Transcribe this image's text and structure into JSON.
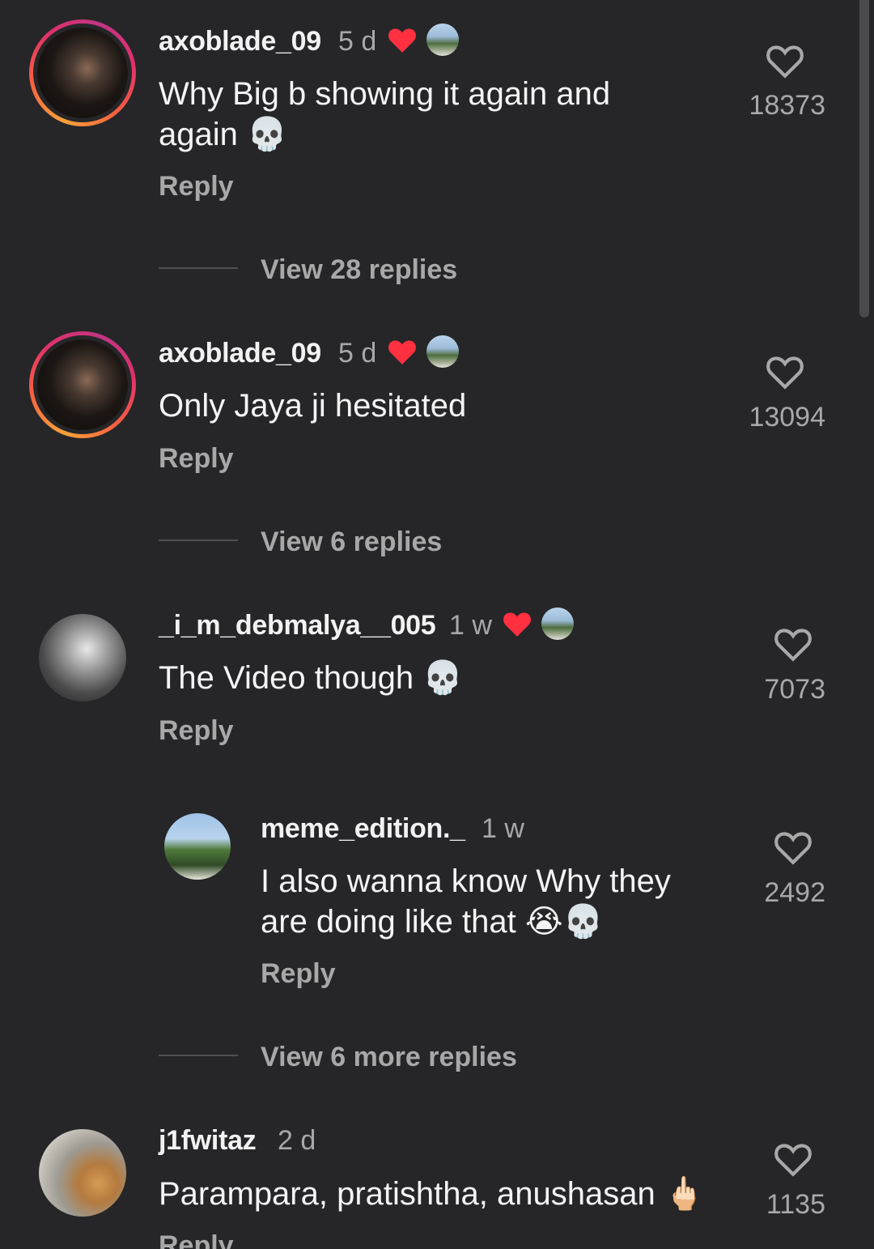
{
  "comments": [
    {
      "username": "axoblade_09",
      "time": "5 d",
      "text": "Why Big b showing it again and\nagain 💀",
      "reply_label": "Reply",
      "likes": "18373",
      "view_replies": "View 28 replies",
      "liked_by_creator": true
    },
    {
      "username": "axoblade_09",
      "time": "5 d",
      "text": "Only Jaya ji hesitated",
      "reply_label": "Reply",
      "likes": "13094",
      "view_replies": "View 6 replies",
      "liked_by_creator": true
    },
    {
      "username": "_i_m_debmalya__005",
      "time": "1 w",
      "text": "The Video though 💀",
      "reply_label": "Reply",
      "likes": "7073",
      "liked_by_creator": true
    },
    {
      "username": "meme_edition._",
      "time": "1 w",
      "text": "I also wanna know Why they\nare doing like that 😭💀",
      "reply_label": "Reply",
      "likes": "2492",
      "view_replies": "View 6 more replies",
      "is_reply": true
    },
    {
      "username": "j1fwitaz",
      "time": "2 d",
      "text": "Parampara, pratishtha, anushasan 🖕🏻",
      "reply_label": "Reply",
      "likes": "1135"
    }
  ],
  "icons": {
    "like": "heart-outline-icon",
    "creator_heart": "heart-filled-icon"
  },
  "colors": {
    "background": "#262628",
    "heart_red": "#ff3040",
    "secondary_text": "#a8a8a8"
  }
}
